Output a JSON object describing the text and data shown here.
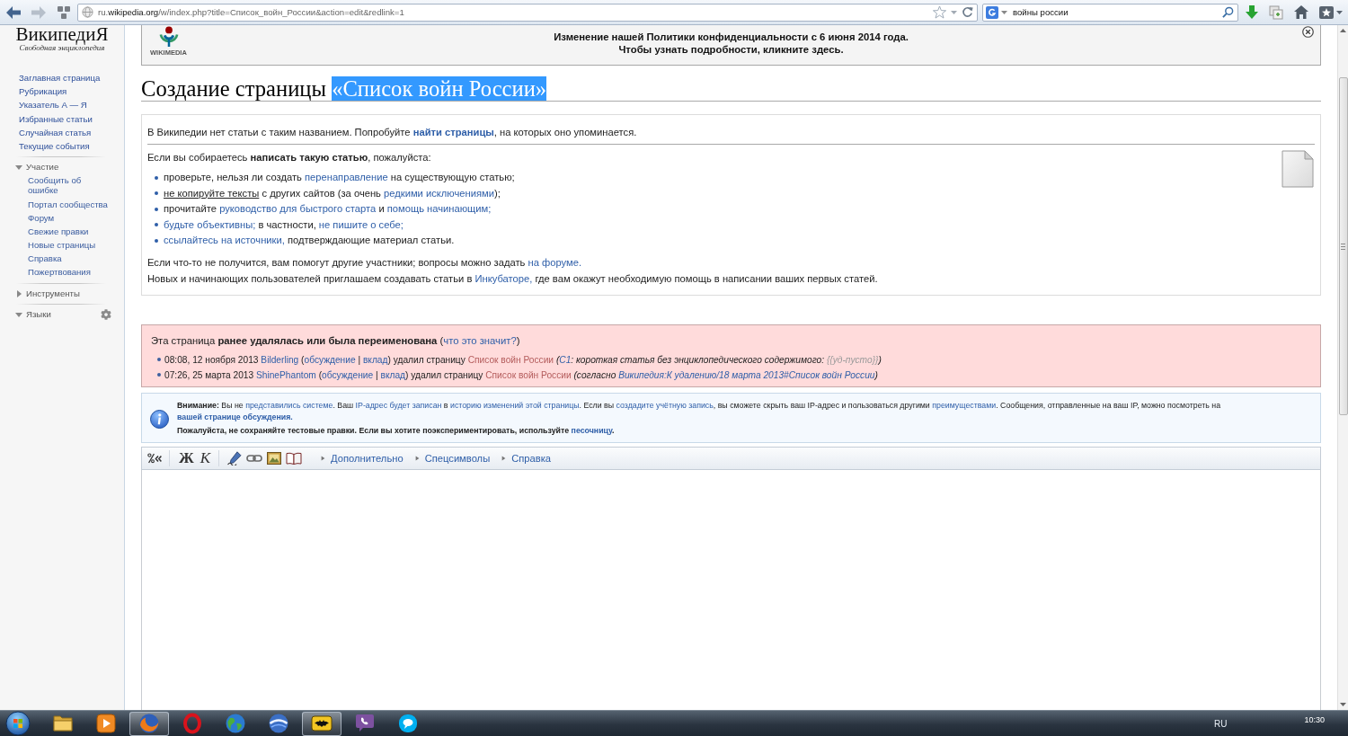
{
  "browser": {
    "nav": [
      {
        "kind": "back",
        "disabled": false
      },
      {
        "kind": "forward",
        "disabled": true
      },
      {
        "kind": "history",
        "disabled": false
      }
    ],
    "url": "ru.**wikipedia.org**/w/index.php?title=Список_войн_России&action=edit&redlink=1",
    "bookmarked": false,
    "search": {
      "value": "войны россии"
    },
    "tools": [
      {
        "kind": "download"
      },
      {
        "kind": "stack"
      },
      {
        "kind": "home"
      },
      {
        "kind": "bookmarks"
      }
    ]
  },
  "sidebar": {
    "logo": {
      "title": "ВикипедиЯ",
      "tagline": "Свободная энциклопедия"
    },
    "navigation": [
      "Заглавная страница",
      "Рубрикация",
      "Указатель А — Я",
      "Избранные статьи",
      "Случайная статья",
      "Текущие события"
    ],
    "sections": [
      {
        "title": "Участие",
        "expanded": true,
        "items": [
          "Сообщить об ошибке",
          "Портал сообщества",
          "Форум",
          "Свежие правки",
          "Новые страницы",
          "Справка",
          "Пожертвования"
        ]
      },
      {
        "title": "Инструменты",
        "expanded": false
      },
      {
        "title": "Языки",
        "expanded": true,
        "settings": true
      }
    ]
  },
  "banner": {
    "logo_text": "WIKIMEDIA",
    "lines": [
      "Изменение нашей Политики конфиденциальности с 6 июня 2014 года.",
      "Чтобы узнать подробности, кликните здесь."
    ]
  },
  "heading": {
    "text": "Создание страницы",
    "selected_text": "«Список войн России»"
  },
  "notice": {
    "intro": [
      {
        "text": "В Википедии нет статьи с таким названием. Попробуйте ",
        "kind": "text"
      },
      {
        "text": "найти страницы",
        "kind": "strong-link"
      },
      {
        "text": ", на которых оно упоминается.",
        "kind": "text"
      }
    ],
    "lead": [
      {
        "text": "Если вы собираетесь ",
        "kind": "text"
      },
      {
        "text": "написать такую статью",
        "kind": "strong"
      },
      {
        "text": ", пожалуйста:",
        "kind": "text"
      }
    ],
    "tips": [
      [
        {
          "text": "проверьте, нельзя ли создать ",
          "kind": "text"
        },
        {
          "text": "перенаправление",
          "kind": "link"
        },
        {
          "text": " на существующую статью;",
          "kind": "text"
        }
      ],
      [
        {
          "text": "не копируйте тексты",
          "kind": "underlined"
        },
        {
          "text": " с других сайтов (за очень ",
          "kind": "text"
        },
        {
          "text": "редкими исключениями",
          "kind": "link"
        },
        {
          "text": ");",
          "kind": "text"
        }
      ],
      [
        {
          "text": "прочитайте ",
          "kind": "text"
        },
        {
          "text": "руководство для быстрого старта",
          "kind": "link"
        },
        {
          "text": " и ",
          "kind": "text"
        },
        {
          "text": "помощь начинающим;",
          "kind": "link"
        }
      ],
      [
        {
          "text": "будьте объективны;",
          "kind": "link"
        },
        {
          "text": " в частности, ",
          "kind": "text"
        },
        {
          "text": "не пишите о себе;",
          "kind": "link"
        }
      ],
      [
        {
          "text": "ссылайтесь на источники,",
          "kind": "link"
        },
        {
          "text": " подтверждающие материал статьи.",
          "kind": "text"
        }
      ]
    ],
    "outro": [
      [
        {
          "text": "Если что-то не получится, вам помогут другие участники; вопросы можно задать ",
          "kind": "text"
        },
        {
          "text": "на форуме.",
          "kind": "link"
        }
      ],
      [
        {
          "text": "Новых и начинающих пользователей приглашаем создавать статьи в ",
          "kind": "text"
        },
        {
          "text": "Инкубаторе,",
          "kind": "link"
        },
        {
          "text": " где вам окажут необходимую помощь в написании ваших первых статей.",
          "kind": "text"
        }
      ]
    ]
  },
  "deletion_log": {
    "message": [
      {
        "text": "Эта страница ",
        "kind": "text"
      },
      {
        "text": "ранее удалялась или была переименована",
        "kind": "strong"
      },
      {
        "text": " (",
        "kind": "text"
      },
      {
        "text": "что это значит?",
        "kind": "link"
      },
      {
        "text": ")",
        "kind": "text"
      }
    ],
    "entries": [
      [
        {
          "text": "08:08, 12 ноября 2013 ",
          "kind": "text"
        },
        {
          "text": "Bilderling",
          "kind": "link"
        },
        {
          "text": " (",
          "kind": "text"
        },
        {
          "text": "обсуждение",
          "kind": "link"
        },
        {
          "text": " | ",
          "kind": "text"
        },
        {
          "text": "вклад",
          "kind": "link"
        },
        {
          "text": ") удалил страницу ",
          "kind": "text"
        },
        {
          "text": "Список войн России",
          "kind": "new-link"
        },
        {
          "text": " (",
          "kind": "em"
        },
        {
          "text": "С1",
          "kind": "em-link"
        },
        {
          "text": ": короткая статья без энциклопедического содержимого: ",
          "kind": "em"
        },
        {
          "text": "{{уд-пусто}}",
          "kind": "template"
        },
        {
          "text": ")",
          "kind": "em"
        }
      ],
      [
        {
          "text": "07:26, 25 марта 2013 ",
          "kind": "text"
        },
        {
          "text": "ShinePhantom",
          "kind": "link"
        },
        {
          "text": " (",
          "kind": "text"
        },
        {
          "text": "обсуждение",
          "kind": "link"
        },
        {
          "text": " | ",
          "kind": "text"
        },
        {
          "text": "вклад",
          "kind": "link"
        },
        {
          "text": ") удалил страницу ",
          "kind": "text"
        },
        {
          "text": "Список войн России",
          "kind": "new-link"
        },
        {
          "text": " (согласно ",
          "kind": "em"
        },
        {
          "text": "Википедия:К удалению/18 марта 2013#Список войн России",
          "kind": "em-link"
        },
        {
          "text": ")",
          "kind": "em"
        }
      ]
    ]
  },
  "edit_warning": {
    "paragraphs": [
      [
        {
          "text": "Внимание:",
          "kind": "strong"
        },
        {
          "text": " Вы не ",
          "kind": "text"
        },
        {
          "text": "представились системе",
          "kind": "link"
        },
        {
          "text": ". Ваш ",
          "kind": "text"
        },
        {
          "text": "IP-адрес будет записан",
          "kind": "link"
        },
        {
          "text": " в ",
          "kind": "text"
        },
        {
          "text": "историю изменений этой страницы",
          "kind": "link"
        },
        {
          "text": ". Если вы ",
          "kind": "text"
        },
        {
          "text": "создадите учётную запись",
          "kind": "link"
        },
        {
          "text": ", вы сможете скрыть ваш IP-адрес и пользоваться другими ",
          "kind": "text"
        },
        {
          "text": "преимуществами",
          "kind": "link"
        },
        {
          "text": ". Сообщения, отправленные на ваш IP, можно посмотреть на ",
          "kind": "text"
        },
        {
          "text": "вашей странице обсуждения.",
          "kind": "strong-link"
        }
      ],
      [
        {
          "text": "Пожалуйста, не сохраняйте тестовые правки. Если вы хотите поэкспериментировать, используйте ",
          "kind": "strong"
        },
        {
          "text": "песочницу",
          "kind": "strong-link"
        },
        {
          "text": ".",
          "kind": "strong"
        }
      ]
    ]
  },
  "editor": {
    "tool_groups": [
      [
        {
          "kind": "wikify"
        }
      ],
      [
        {
          "kind": "bold",
          "label": "Ж"
        },
        {
          "kind": "italic",
          "label": "К"
        }
      ],
      [
        {
          "kind": "signature"
        },
        {
          "kind": "link"
        },
        {
          "kind": "image"
        },
        {
          "kind": "reference"
        }
      ]
    ],
    "menus": [
      {
        "label": "Дополнительно",
        "expanded": false
      },
      {
        "label": "Спецсимволы",
        "expanded": false
      },
      {
        "label": "Справка",
        "expanded": false
      }
    ]
  },
  "taskbar": {
    "apps": [
      {
        "kind": "folder",
        "running": false
      },
      {
        "kind": "player",
        "running": false
      },
      {
        "kind": "fox",
        "running": true
      },
      {
        "kind": "ring",
        "running": false
      },
      {
        "kind": "globe",
        "running": false
      },
      {
        "kind": "sphere",
        "running": false
      },
      {
        "kind": "bat",
        "running": true
      },
      {
        "kind": "phone",
        "running": false
      },
      {
        "kind": "chat",
        "running": false
      }
    ],
    "language": "RU",
    "time": "10:30"
  }
}
